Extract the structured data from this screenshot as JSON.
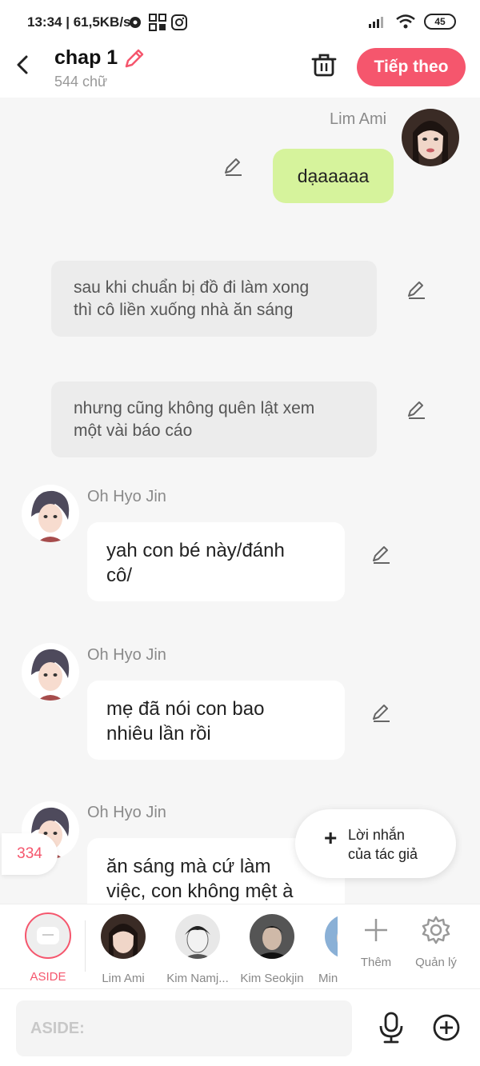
{
  "status_bar": {
    "time": "13:34",
    "speed": "61,5KB/s",
    "battery": "45",
    "icons": [
      "data-saver-icon",
      "qr-icon",
      "instagram-icon",
      "signal-icon",
      "wifi-icon",
      "battery-icon"
    ]
  },
  "header": {
    "title": "chap 1",
    "word_count": "544 chữ",
    "next_label": "Tiếp theo",
    "accent_color": "#f5566d"
  },
  "messages": [
    {
      "type": "me",
      "name": "Lim Ami",
      "text": "dạaaaaa"
    },
    {
      "type": "narration",
      "text_line1": "sau khi chuẩn bị đồ đi làm xong",
      "text_line2": "thì cô liền xuống nhà ăn sáng"
    },
    {
      "type": "narration",
      "text_line1": "nhưng cũng không quên lật xem",
      "text_line2": "một vài báo cáo"
    },
    {
      "type": "other",
      "name": "Oh Hyo Jin",
      "text_line1": "yah con bé này/đánh",
      "text_line2": "cô/"
    },
    {
      "type": "other",
      "name": "Oh Hyo Jin",
      "text_line1": "mẹ đã nói con bao",
      "text_line2": "nhiêu lần rồi"
    },
    {
      "type": "other",
      "name": "Oh Hyo Jin",
      "text_line1": "ăn sáng mà cứ làm",
      "text_line2": "việc, con không mệt à"
    }
  ],
  "floating": {
    "badge_count": "334",
    "author_note_line1": "Lời nhắn",
    "author_note_line2": "của tác giả"
  },
  "characters": [
    {
      "label": "ASIDE",
      "active": true
    },
    {
      "label": "Lim Ami"
    },
    {
      "label": "Kim Namj..."
    },
    {
      "label": "Kim Seokjin"
    },
    {
      "label": "Min"
    }
  ],
  "actions": {
    "add_label": "Thêm",
    "manage_label": "Quản lý"
  },
  "input": {
    "placeholder": "ASIDE:"
  }
}
